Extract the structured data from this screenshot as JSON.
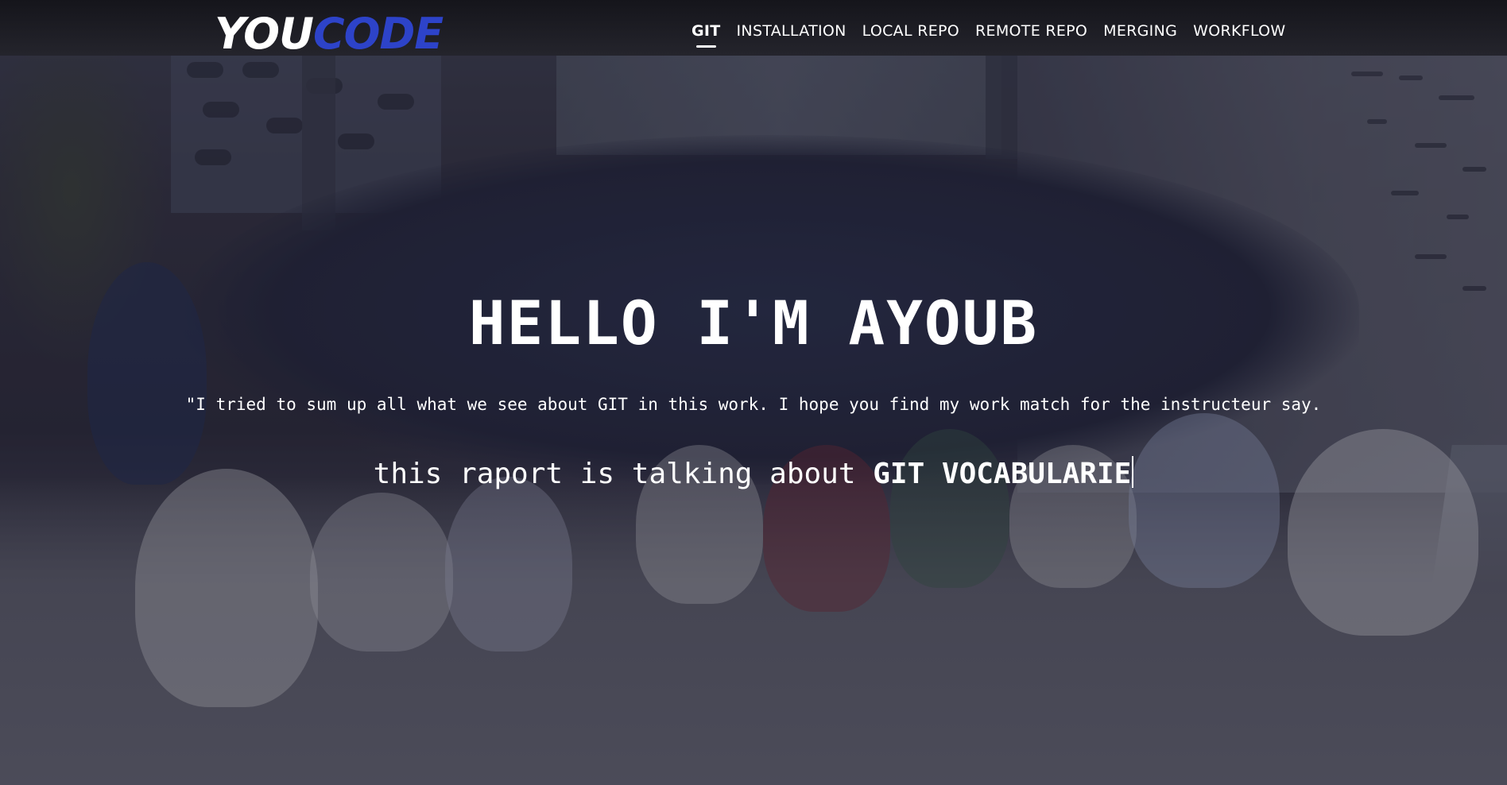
{
  "brand": {
    "you": "YOU",
    "code": "CODE"
  },
  "nav": {
    "items": [
      {
        "label": "GIT",
        "active": true
      },
      {
        "label": "INSTALLATION",
        "active": false
      },
      {
        "label": "LOCAL REPO",
        "active": false
      },
      {
        "label": "REMOTE REPO",
        "active": false
      },
      {
        "label": "MERGING",
        "active": false
      },
      {
        "label": "WORKFLOW",
        "active": false
      }
    ]
  },
  "hero": {
    "title": "HELLO I'M AYOUB",
    "quote": "\"I tried to sum up all what we see about GIT in this work. I hope you find my work match for the instructeur say.",
    "typed_prefix": "this raport is talking about",
    "typed_word": "GIT VOCABULARIE"
  },
  "colors": {
    "brand_blue": "#2d43c9",
    "text": "#ffffff"
  }
}
